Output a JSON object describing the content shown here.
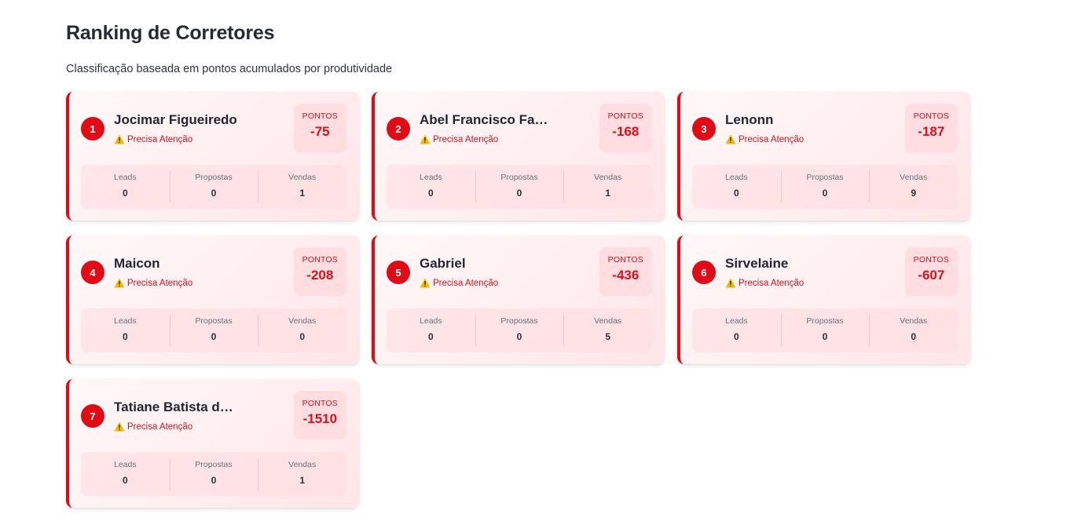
{
  "page": {
    "title": "Ranking de Corretores",
    "subtitle": "Classificação baseada em pontos acumulados por produtividade"
  },
  "colors": {
    "accent": "#e10b17",
    "card_bg": "#ffeef0",
    "warning": "#f5b800"
  },
  "labels": {
    "points": "PONTOS",
    "leads": "Leads",
    "proposals": "Propostas",
    "sales": "Vendas"
  },
  "cards": [
    {
      "rank": "1",
      "name": "Jocimar Figueiredo",
      "status": "Precisa Atenção",
      "status_icon": "warning-icon",
      "points": "-75",
      "leads": "0",
      "proposals": "0",
      "sales": "1"
    },
    {
      "rank": "2",
      "name": "Abel Francisco Fa…",
      "status": "Precisa Atenção",
      "status_icon": "warning-icon",
      "points": "-168",
      "leads": "0",
      "proposals": "0",
      "sales": "1"
    },
    {
      "rank": "3",
      "name": "Lenonn",
      "status": "Precisa Atenção",
      "status_icon": "warning-icon",
      "points": "-187",
      "leads": "0",
      "proposals": "0",
      "sales": "9"
    },
    {
      "rank": "4",
      "name": "Maicon",
      "status": "Precisa Atenção",
      "status_icon": "warning-icon",
      "points": "-208",
      "leads": "0",
      "proposals": "0",
      "sales": "0"
    },
    {
      "rank": "5",
      "name": "Gabriel",
      "status": "Precisa Atenção",
      "status_icon": "warning-icon",
      "points": "-436",
      "leads": "0",
      "proposals": "0",
      "sales": "5"
    },
    {
      "rank": "6",
      "name": "Sirvelaine",
      "status": "Precisa Atenção",
      "status_icon": "warning-icon",
      "points": "-607",
      "leads": "0",
      "proposals": "0",
      "sales": "0"
    },
    {
      "rank": "7",
      "name": "Tatiane Batista d…",
      "status": "Precisa Atenção",
      "status_icon": "warning-icon",
      "points": "-1510",
      "leads": "0",
      "proposals": "0",
      "sales": "1"
    }
  ]
}
